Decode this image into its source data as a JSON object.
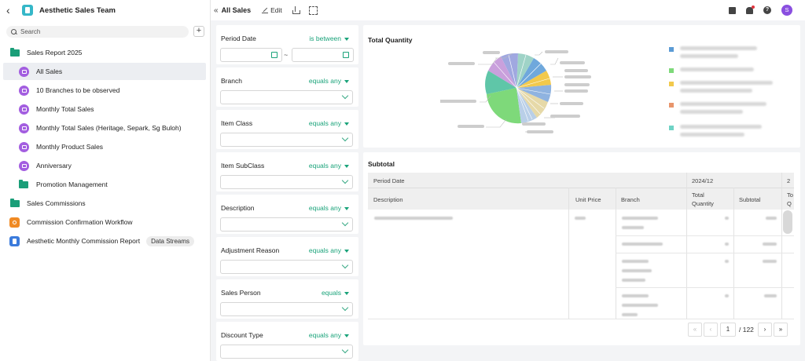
{
  "app": {
    "title": "Aesthetic Sales Team"
  },
  "search": {
    "placeholder": "Search"
  },
  "sidebar": {
    "items": [
      {
        "label": "Sales Report 2025",
        "type": "folder"
      },
      {
        "label": "All Sales",
        "type": "page",
        "selected": true
      },
      {
        "label": "10 Branches to be observed",
        "type": "page"
      },
      {
        "label": "Monthly Total Sales",
        "type": "page"
      },
      {
        "label": "Monthly Total Sales (Heritage, Separk, Sg Buloh)",
        "type": "page"
      },
      {
        "label": "Monthly Product Sales",
        "type": "page"
      },
      {
        "label": "Anniversary",
        "type": "page"
      },
      {
        "label": "Promotion Management",
        "type": "folder"
      },
      {
        "label": "Sales Commissions",
        "type": "folder"
      },
      {
        "label": "Commission Confirmation Workflow",
        "type": "workflow"
      },
      {
        "label": "Aesthetic Monthly Commission Report",
        "type": "report",
        "chip": "Data Streams"
      }
    ]
  },
  "toolbar": {
    "page_name": "All Sales",
    "edit_label": "Edit",
    "avatar_initial": "S"
  },
  "filters": [
    {
      "label": "Period Date",
      "op": "is between"
    },
    {
      "label": "Branch",
      "op": "equals any"
    },
    {
      "label": "Item Class",
      "op": "equals any"
    },
    {
      "label": "Item SubClass",
      "op": "equals any"
    },
    {
      "label": "Description",
      "op": "equals any"
    },
    {
      "label": "Adjustment Reason",
      "op": "equals any"
    },
    {
      "label": "Sales Person",
      "op": "equals"
    },
    {
      "label": "Discount Type",
      "op": "equals any"
    }
  ],
  "date_separator": "~",
  "chart": {
    "title": "Total Quantity",
    "legend_colors": [
      "#5b9bd5",
      "#7ed97a",
      "#f2c94c",
      "#e8956b",
      "#6fd3c5"
    ]
  },
  "table": {
    "title": "Subtotal",
    "period_header": "Period Date",
    "period_value": "2024/12",
    "period_value_2": "2",
    "columns": [
      "Description",
      "Unit Price",
      "Branch",
      "Total Quantity",
      "Subtotal",
      "To Q"
    ]
  },
  "pager": {
    "page": "1",
    "total": "/ 122"
  },
  "colors": {
    "accent": "#1aa37a",
    "folder": "#1a9e78",
    "page_icon": "#a35ee0",
    "selected_bg": "#eceef2"
  }
}
